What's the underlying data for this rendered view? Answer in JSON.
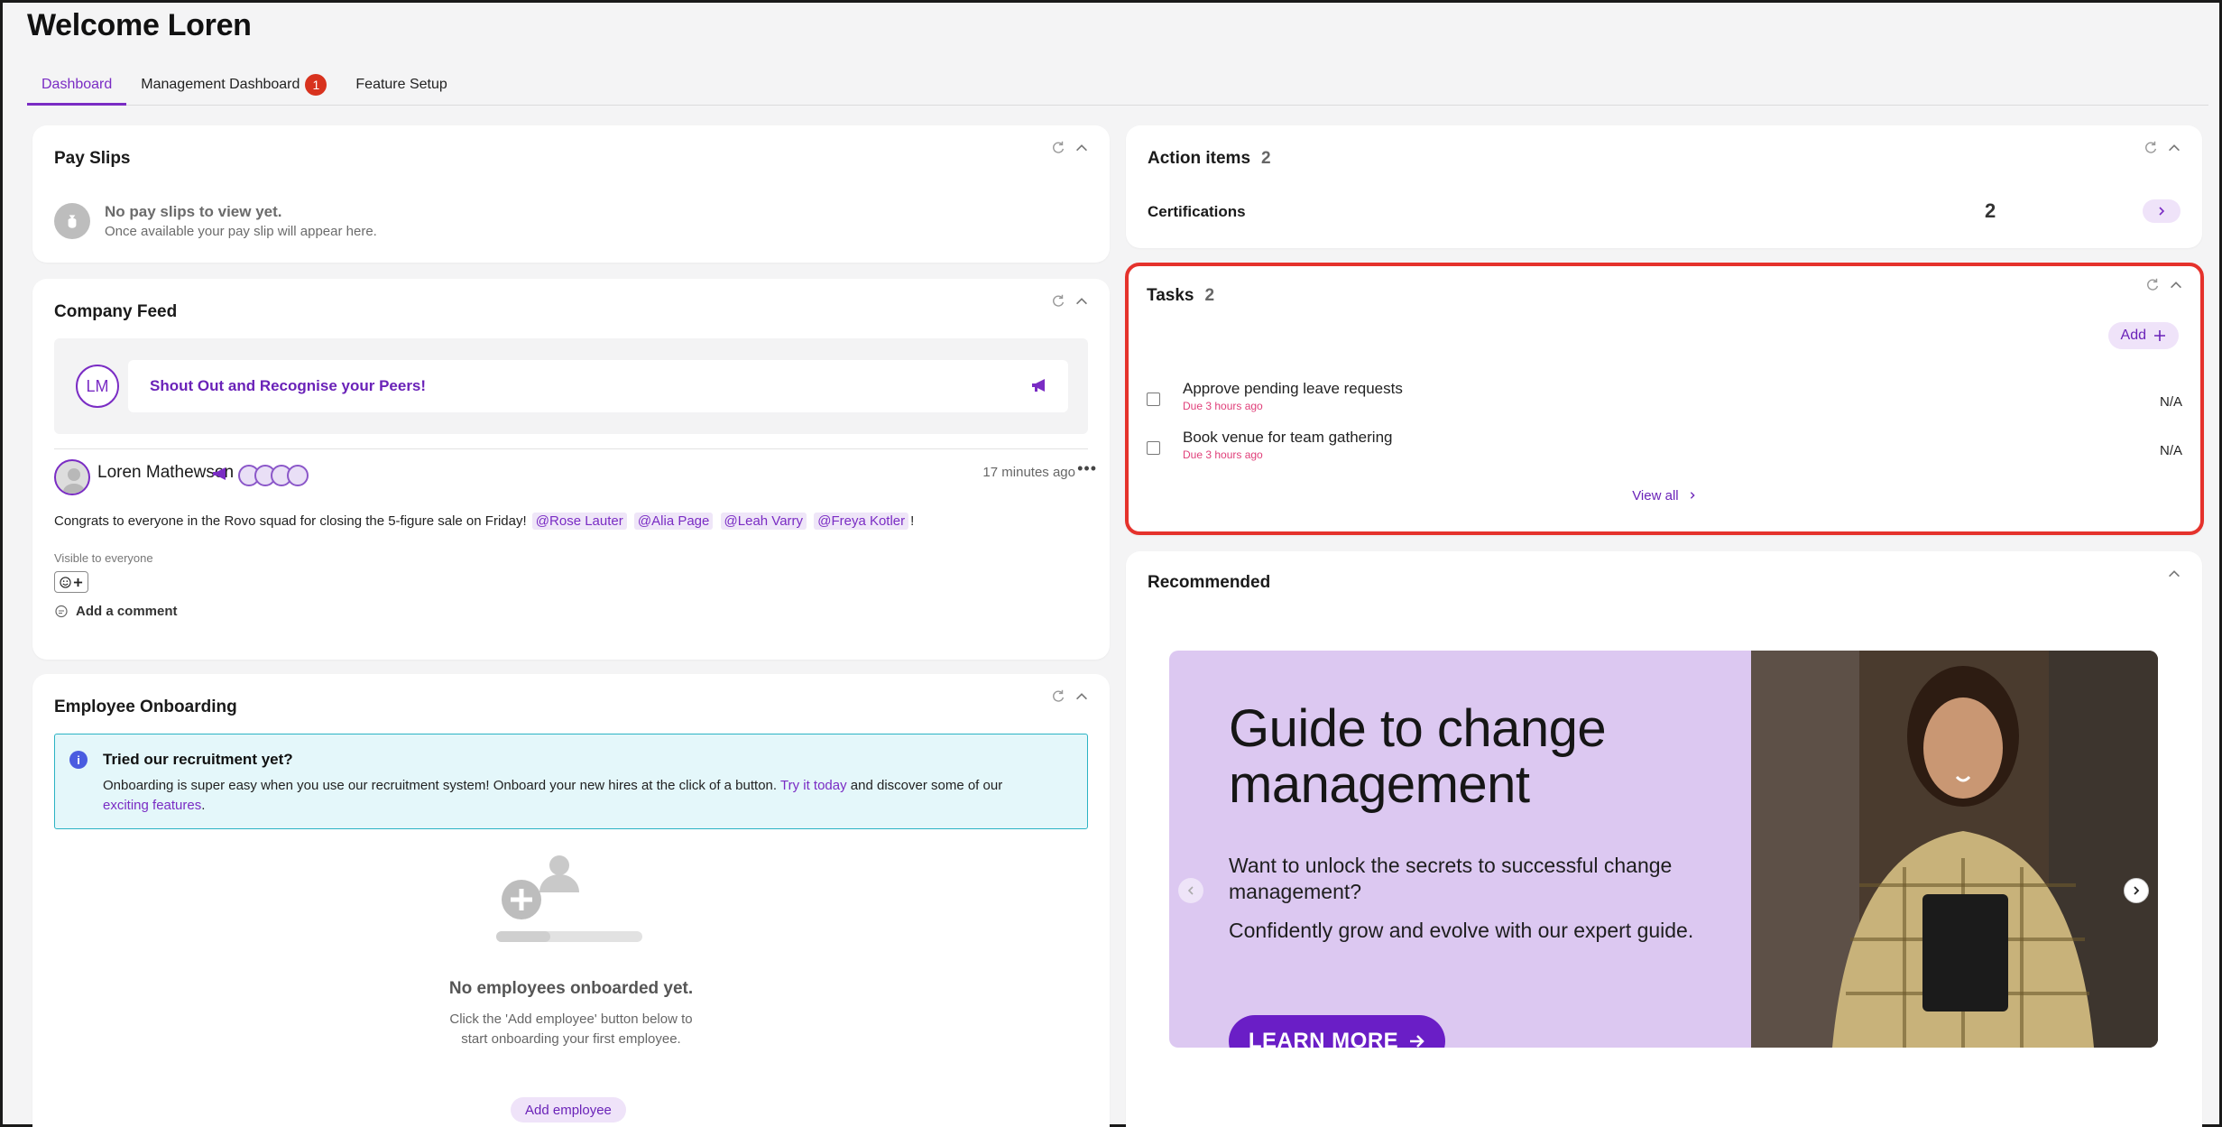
{
  "page": {
    "title": "Welcome Loren"
  },
  "tabs": [
    {
      "label": "Dashboard",
      "active": true
    },
    {
      "label": "Management Dashboard",
      "badge": "1"
    },
    {
      "label": "Feature Setup"
    }
  ],
  "pay_slips": {
    "title": "Pay Slips",
    "empty_title": "No pay slips to view yet.",
    "empty_sub": "Once available your pay slip will appear here."
  },
  "company_feed": {
    "title": "Company Feed",
    "avatar_initials": "LM",
    "shout_out": "Shout Out and Recognise your Peers!",
    "post": {
      "author": "Loren Mathewson",
      "time": "17 minutes ago",
      "text_before": "Congrats to everyone in the Rovo squad for closing the 5-figure sale on Friday!",
      "mentions": [
        "@Rose Lauter",
        "@Alia Page",
        "@Leah Varry",
        "@Freya Kotler"
      ],
      "text_after": "!",
      "visibility": "Visible to everyone",
      "add_comment": "Add a comment"
    }
  },
  "onboarding": {
    "title": "Employee Onboarding",
    "info_title": "Tried our recruitment yet?",
    "info_text_1": "Onboarding is super easy when you use our recruitment system! Onboard your new hires at the click of a button.",
    "info_link_1": "Try it today",
    "info_text_2": "and discover some of our",
    "info_link_2": "exciting features",
    "info_text_3": ".",
    "empty_title": "No employees onboarded yet.",
    "empty_sub_1": "Click the 'Add employee' button below to",
    "empty_sub_2": "start onboarding your first employee.",
    "add_button": "Add employee"
  },
  "action_items": {
    "title": "Action items",
    "count": "2",
    "cert_label": "Certifications",
    "cert_count": "2"
  },
  "tasks": {
    "title": "Tasks",
    "count": "2",
    "add_label": "Add",
    "items": [
      {
        "title": "Approve pending leave requests",
        "due": "Due 3 hours ago",
        "assignee": "N/A"
      },
      {
        "title": "Book venue for team gathering",
        "due": "Due 3 hours ago",
        "assignee": "N/A"
      }
    ],
    "view_all": "View all"
  },
  "recommended": {
    "title": "Recommended",
    "banner_title": "Guide to change management",
    "banner_p1": "Want to unlock the secrets to successful change management?",
    "banner_p2": "Confidently grow and evolve with our expert guide.",
    "banner_cta": "LEARN MORE"
  },
  "colors": {
    "accent": "#7a2cc4",
    "badge_red": "#d8321e",
    "highlight": "#e5322c",
    "banner_bg": "#dcc8f1"
  }
}
